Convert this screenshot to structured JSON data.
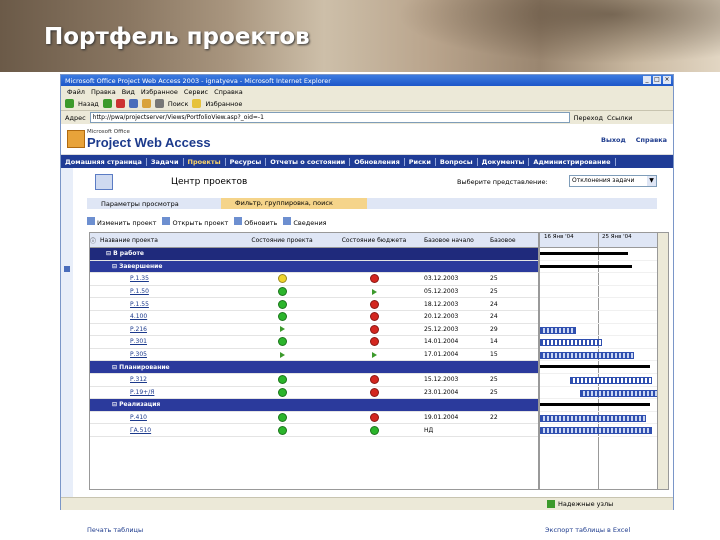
{
  "slide": {
    "title": "Портфель проектов"
  },
  "window": {
    "title": "Microsoft Office Project Web Access 2003 - ignatyeva - Microsoft Internet Explorer"
  },
  "menu": [
    "Файл",
    "Правка",
    "Вид",
    "Избранное",
    "Сервис",
    "Справка"
  ],
  "toolbar": {
    "back": "Назад",
    "search": "Поиск",
    "favorites": "Избранное"
  },
  "address": {
    "label": "Адрес",
    "value": "http://pwa/projectserver/Views/PortfolioView.asp?_oid=-1",
    "go": "Переход",
    "links": "Ссылки"
  },
  "app": {
    "logo_small": "Microsoft Office",
    "logo_main": "Project Web Access",
    "logout": "Выход",
    "help": "Справка"
  },
  "nav": [
    "Домашняя страница",
    "Задачи",
    "Проекты",
    "Ресурсы",
    "Отчеты о состоянии",
    "Обновления",
    "Риски",
    "Вопросы",
    "Документы",
    "Администрирование"
  ],
  "page": {
    "title": "Центр проектов",
    "view_label": "Выберите представление:",
    "view_value": "Отклонения задачи"
  },
  "tabs": {
    "t1": "Параметры просмотра",
    "t2": "Фильтр, группировка, поиск"
  },
  "actions": [
    "Изменить проект",
    "Открыть проект",
    "Обновить",
    "Сведения"
  ],
  "columns": [
    "Название проекта",
    "Состояние проекта",
    "Состояние бюджета",
    "Базовое начало",
    "Базовое"
  ],
  "rows": [
    {
      "type": "group1",
      "name": "В работе"
    },
    {
      "type": "group2",
      "name": "Завершение"
    },
    {
      "type": "task",
      "name": "Р.1.35",
      "s1": "yellow",
      "s2": "red",
      "date": "03.12.2003",
      "n": "25"
    },
    {
      "type": "task",
      "name": "Р.1.50",
      "s1": "green",
      "s2": "flag",
      "date": "05.12.2003",
      "n": "25"
    },
    {
      "type": "task",
      "name": "Р.1.55",
      "s1": "green",
      "s2": "red",
      "date": "18.12.2003",
      "n": "24"
    },
    {
      "type": "task",
      "name": "4.100",
      "s1": "green",
      "s2": "red",
      "date": "20.12.2003",
      "n": "24"
    },
    {
      "type": "task",
      "name": "Р.216",
      "s1": "flag",
      "s2": "red",
      "date": "25.12.2003",
      "n": "29"
    },
    {
      "type": "task",
      "name": "Р.301",
      "s1": "green",
      "s2": "red",
      "date": "14.01.2004",
      "n": "14"
    },
    {
      "type": "task",
      "name": "Р.305",
      "s1": "flag",
      "s2": "flag",
      "date": "17.01.2004",
      "n": "15"
    },
    {
      "type": "group2",
      "name": "Планирование"
    },
    {
      "type": "task",
      "name": "Р.312",
      "s1": "green",
      "s2": "red",
      "date": "15.12.2003",
      "n": "25"
    },
    {
      "type": "task",
      "name": "Р.19+/Я",
      "s1": "green",
      "s2": "red",
      "date": "23.01.2004",
      "n": "25"
    },
    {
      "type": "group2",
      "name": "Реализация"
    },
    {
      "type": "task",
      "name": "Р.410",
      "s1": "green",
      "s2": "red",
      "date": "19.01.2004",
      "n": "22"
    },
    {
      "type": "task",
      "name": "ГА.510",
      "s1": "green",
      "s2": "green",
      "date": "НД",
      "n": ""
    }
  ],
  "gantt": {
    "week1": "16 Янв '04",
    "week2": "25 Янв '04"
  },
  "footer": {
    "print": "Печать таблицы",
    "export": "Экспорт таблицы в Excel"
  },
  "status": {
    "zone": "Надежные узлы"
  }
}
